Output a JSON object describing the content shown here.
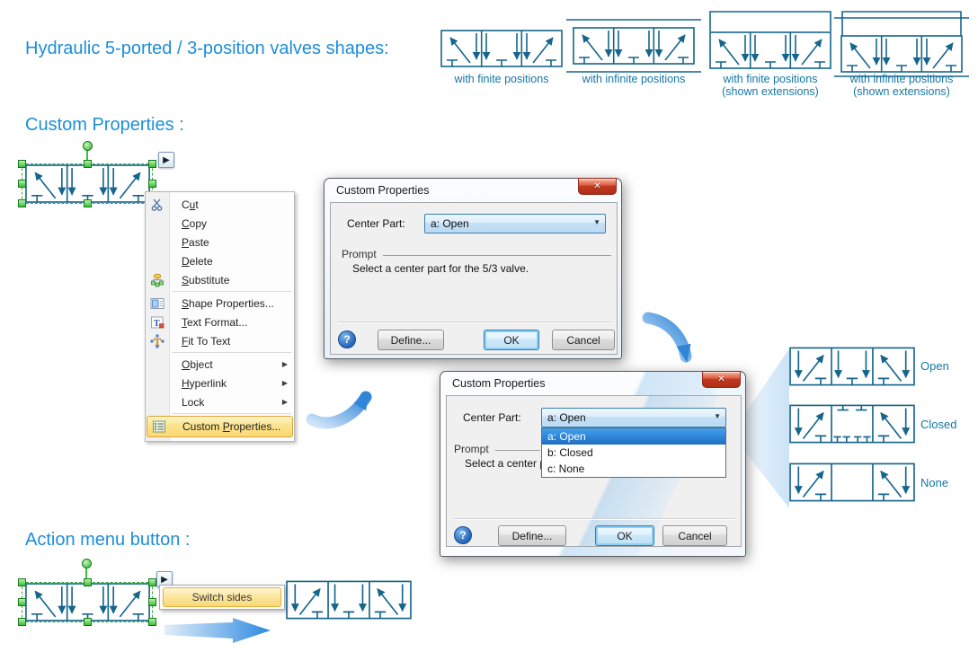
{
  "headings": {
    "main": "Hydraulic 5-ported / 3-position valves shapes:",
    "custom_properties": "Custom Properties :",
    "action_menu": "Action menu button :"
  },
  "gallery": {
    "items": [
      {
        "line1": "with finite positions",
        "line2": ""
      },
      {
        "line1": "with infinite positions",
        "line2": ""
      },
      {
        "line1": "with finite positions",
        "line2": "(shown extensions)"
      },
      {
        "line1": "with infinite positions",
        "line2": "(shown extensions)"
      }
    ]
  },
  "menu": {
    "items": [
      {
        "pre": "C",
        "key": "u",
        "post": "t"
      },
      {
        "pre": "",
        "key": "C",
        "post": "opy"
      },
      {
        "pre": "",
        "key": "P",
        "post": "aste"
      },
      {
        "pre": "",
        "key": "D",
        "post": "elete"
      },
      {
        "pre": "",
        "key": "S",
        "post": "ubstitute"
      },
      {
        "pre": "",
        "key": "S",
        "post": "hape Properties..."
      },
      {
        "pre": "",
        "key": "T",
        "post": "ext Format..."
      },
      {
        "pre": "",
        "key": "F",
        "post": "it To Text"
      },
      {
        "pre": "",
        "key": "O",
        "post": "bject"
      },
      {
        "pre": "",
        "key": "H",
        "post": "yperlink"
      },
      {
        "pre": "Lock",
        "key": "",
        "post": ""
      },
      {
        "pre": "Custom ",
        "key": "P",
        "post": "roperties..."
      }
    ]
  },
  "dialog1": {
    "title": "Custom Properties",
    "center_part_label": "Center Part:",
    "combo_value": "a: Open",
    "prompt_label": "Prompt",
    "prompt_text": "Select a center part for the 5/3 valve.",
    "define_label": "Define...",
    "ok_label": "OK",
    "cancel_label": "Cancel"
  },
  "dialog2": {
    "title": "Custom Properties",
    "center_part_label": "Center Part:",
    "combo_value": "a: Open",
    "options": [
      {
        "label": "a: Open"
      },
      {
        "label": "b: Closed"
      },
      {
        "label": "c: None"
      }
    ],
    "prompt_label": "Prompt",
    "prompt_text_clipped": "Select a center part f",
    "define_label": "Define...",
    "ok_label": "OK",
    "cancel_label": "Cancel"
  },
  "valves": {
    "items": [
      {
        "label": "Open"
      },
      {
        "label": "Closed"
      },
      {
        "label": "None"
      }
    ]
  },
  "action": {
    "switch_sides": "Switch sides"
  },
  "icons": {
    "action_button": "▶",
    "submenu_arrow": "▶",
    "combo_arrow": "▼",
    "help": "?",
    "close": "✕"
  },
  "colors": {
    "heading_blue": "#1e8ed8",
    "valve_stroke": "#15658c",
    "valve_label_blue": "#1577a5",
    "selection_green": "#2fae2f",
    "menu_highlight_border": "#e2a33c",
    "close_button_red": "#c23a22",
    "focus_blue": "#2c7cb8",
    "dropdown_selected_blue": "#1f6fc0"
  }
}
